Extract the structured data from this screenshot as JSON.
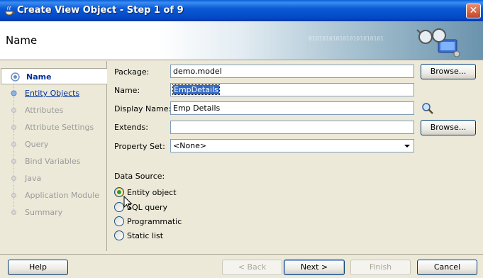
{
  "window": {
    "title": "Create View Object - Step 1 of 9",
    "close_label": "✕"
  },
  "header": {
    "title": "Name",
    "binary_text": "0101010101010101010101"
  },
  "nav": {
    "items": [
      {
        "label": "Name",
        "state": "current"
      },
      {
        "label": "Entity Objects",
        "state": "visited"
      },
      {
        "label": "Attributes",
        "state": "future"
      },
      {
        "label": "Attribute Settings",
        "state": "future"
      },
      {
        "label": "Query",
        "state": "future"
      },
      {
        "label": "Bind Variables",
        "state": "future"
      },
      {
        "label": "Java",
        "state": "future"
      },
      {
        "label": "Application Module",
        "state": "future"
      },
      {
        "label": "Summary",
        "state": "future"
      }
    ]
  },
  "form": {
    "package_label": "Package:",
    "package_value": "demo.model",
    "name_label": "Name:",
    "name_value": "EmpDetails",
    "display_name_label": "Display Name:",
    "display_name_value": "Emp Details",
    "extends_label": "Extends:",
    "extends_value": "",
    "property_set_label": "Property Set:",
    "property_set_value": "<None>",
    "browse_label": "Browse...",
    "data_source_label": "Data Source:",
    "data_source_options": [
      {
        "label": "Entity object",
        "checked": true
      },
      {
        "label": "SQL query",
        "checked": false
      },
      {
        "label": "Programmatic",
        "checked": false
      },
      {
        "label": "Static list",
        "checked": false
      }
    ]
  },
  "buttons": {
    "help": "Help",
    "back": "< Back",
    "next": "Next >",
    "finish": "Finish",
    "cancel": "Cancel"
  },
  "colors": {
    "titlebar": "#0a5ad6",
    "link": "#00309c",
    "disabled_text": "#9a9a9a",
    "selection": "#316ac5"
  }
}
